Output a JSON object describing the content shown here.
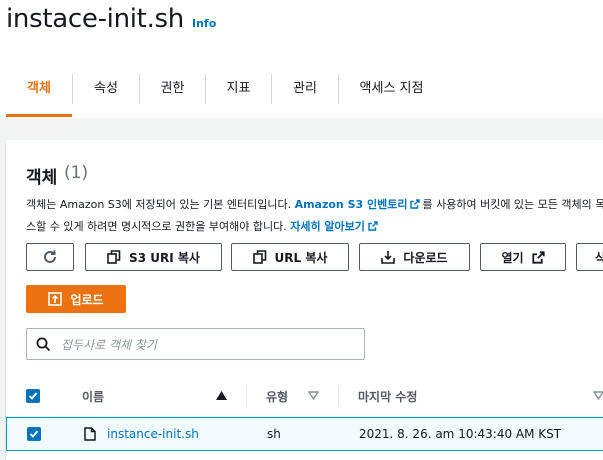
{
  "page": {
    "title": "instace-init.sh",
    "info_label": "Info"
  },
  "tabs": [
    {
      "label": "객체",
      "active": true
    },
    {
      "label": "속성",
      "active": false
    },
    {
      "label": "권한",
      "active": false
    },
    {
      "label": "지표",
      "active": false
    },
    {
      "label": "관리",
      "active": false
    },
    {
      "label": "액세스 지점",
      "active": false
    }
  ],
  "objects": {
    "title": "객체",
    "count": "(1)",
    "description": {
      "part1": "객체는 Amazon S3에 저장되어 있는 기본 엔터티입니다. ",
      "link1": "Amazon S3 인벤토리",
      "part2": "를 사용하여 버킷에 있는 모든 객체의 목",
      "part3": "스할 수 있게 하려면 명시적으로 권한을 부여해야 합니다. ",
      "link2": "자세히 알아보기"
    },
    "toolbar": {
      "copy_s3_uri": "S3 URI 복사",
      "copy_url": "URL 복사",
      "download": "다운로드",
      "open": "열기",
      "cut_off": "삭"
    },
    "upload_label": "업로드",
    "search": {
      "placeholder": "접두사로 객체 찾기",
      "value": ""
    },
    "table": {
      "columns": [
        "이름",
        "유형",
        "마지막 수정"
      ],
      "rows": [
        {
          "selected": true,
          "name": "instance-init.sh",
          "type": "sh",
          "last_modified": "2021. 8. 26. am 10:43:40 AM KST"
        }
      ]
    }
  },
  "colors": {
    "accent": "#ec7211",
    "link": "#0073bb",
    "border": "#545b64"
  }
}
